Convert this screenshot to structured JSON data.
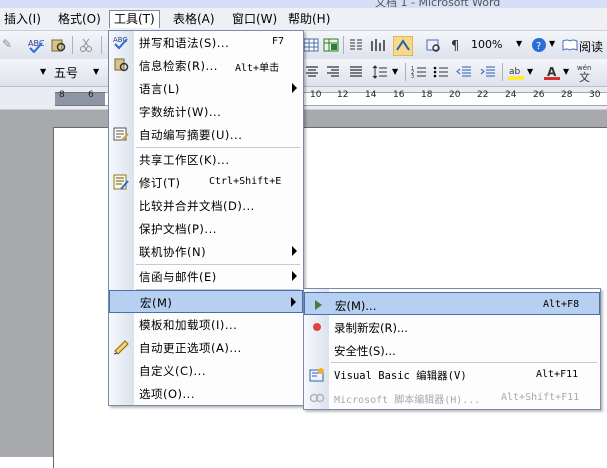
{
  "window": {
    "title": "文档 1 - Microsoft Word"
  },
  "menubar": {
    "items": [
      {
        "label": "插入(I)"
      },
      {
        "label": "格式(O)"
      },
      {
        "label": "工具(T)"
      },
      {
        "label": "表格(A)"
      },
      {
        "label": "窗口(W)"
      },
      {
        "label": "帮助(H)"
      }
    ]
  },
  "toolbar": {
    "zoom": "100%",
    "font_size": "五号",
    "read_label": "阅读"
  },
  "ruler": {
    "labels": [
      "8",
      "6",
      "10",
      "12",
      "14",
      "16",
      "18",
      "20",
      "22",
      "24",
      "26",
      "28",
      "30"
    ]
  },
  "tools_menu": {
    "items": [
      {
        "label": "拼写和语法(S)...",
        "shortcut": "F7"
      },
      {
        "label": "信息检索(R)...",
        "shortcut": "Alt+单击"
      },
      {
        "label": "语言(L)"
      },
      {
        "label": "字数统计(W)..."
      },
      {
        "label": "自动编写摘要(U)..."
      },
      {
        "label": "共享工作区(K)..."
      },
      {
        "label": "修订(T)",
        "shortcut": "Ctrl+Shift+E"
      },
      {
        "label": "比较并合并文档(D)..."
      },
      {
        "label": "保护文档(P)..."
      },
      {
        "label": "联机协作(N)"
      },
      {
        "label": "信函与邮件(E)"
      },
      {
        "label": "宏(M)"
      },
      {
        "label": "模板和加载项(I)..."
      },
      {
        "label": "自动更正选项(A)..."
      },
      {
        "label": "自定义(C)..."
      },
      {
        "label": "选项(O)..."
      }
    ]
  },
  "macro_submenu": {
    "items": [
      {
        "label": "宏(M)...",
        "shortcut": "Alt+F8"
      },
      {
        "label": "录制新宏(R)..."
      },
      {
        "label": "安全性(S)..."
      },
      {
        "label": "Visual Basic 编辑器(V)",
        "shortcut": "Alt+F11"
      },
      {
        "label": "Microsoft 脚本编辑器(H)...",
        "shortcut": "Alt+Shift+F11"
      }
    ]
  },
  "colors": {
    "highlight": "#b7cff0",
    "highlight_border": "#4b6fa8",
    "menu_border": "#7a8aa8",
    "record_dot": "#e0443a"
  }
}
